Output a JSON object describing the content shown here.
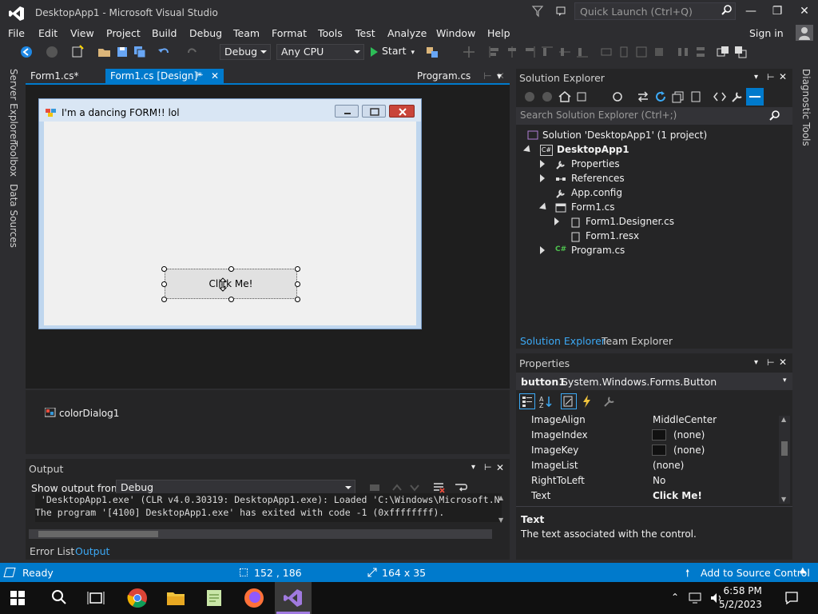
{
  "window": {
    "title": "DesktopApp1 - Microsoft Visual Studio"
  },
  "quick_launch": {
    "placeholder": "Quick Launch (Ctrl+Q)"
  },
  "menu": [
    "File",
    "Edit",
    "View",
    "Project",
    "Build",
    "Debug",
    "Team",
    "Format",
    "Tools",
    "Test",
    "Analyze",
    "Window",
    "Help"
  ],
  "signin": "Sign in",
  "toolbar": {
    "config": "Debug",
    "platform": "Any CPU",
    "start": "Start"
  },
  "left_tabs": [
    "Server Explorer",
    "Toolbox",
    "Data Sources"
  ],
  "right_tabs": [
    "Diagnostic Tools"
  ],
  "doc_tabs": [
    {
      "label": "Form1.cs*"
    },
    {
      "label": "Form1.cs [Design]*"
    },
    {
      "label": "Program.cs"
    }
  ],
  "designer": {
    "form_title": "I'm a dancing FORM!! lol",
    "button_text": "Click Me!",
    "tray_component": "colorDialog1"
  },
  "output": {
    "title": "Output",
    "show_from_label": "Show output from:",
    "source": "Debug",
    "lines": [
      " 'DesktopApp1.exe' (CLR v4.0.30319: DesktopApp1.exe): Loaded 'C:\\Windows\\Microsoft.N",
      "The program '[4100] DesktopApp1.exe' has exited with code -1 (0xffffffff)."
    ]
  },
  "bottom_tabs": [
    "Error List",
    "Output"
  ],
  "solution_explorer": {
    "title": "Solution Explorer",
    "search_placeholder": "Search Solution Explorer (Ctrl+;)",
    "tree": [
      {
        "label": "Solution 'DesktopApp1' (1 project)",
        "level": 0
      },
      {
        "label": "DesktopApp1",
        "level": 1
      },
      {
        "label": "Properties",
        "level": 2
      },
      {
        "label": "References",
        "level": 2
      },
      {
        "label": "App.config",
        "level": 2
      },
      {
        "label": "Form1.cs",
        "level": 2
      },
      {
        "label": "Form1.Designer.cs",
        "level": 3
      },
      {
        "label": "Form1.resx",
        "level": 3
      },
      {
        "label": "Program.cs",
        "level": 2
      }
    ],
    "tabs": [
      "Solution Explorer",
      "Team Explorer"
    ]
  },
  "properties": {
    "title": "Properties",
    "object_name": "button1",
    "object_type": "System.Windows.Forms.Button",
    "rows": [
      {
        "name": "ImageAlign",
        "value": "MiddleCenter"
      },
      {
        "name": "ImageIndex",
        "value": "(none)"
      },
      {
        "name": "ImageKey",
        "value": "(none)"
      },
      {
        "name": "ImageList",
        "value": "(none)"
      },
      {
        "name": "RightToLeft",
        "value": "No"
      },
      {
        "name": "Text",
        "value": "Click Me!"
      }
    ],
    "desc_title": "Text",
    "desc_text": "The text associated with the control."
  },
  "status": {
    "state": "Ready",
    "position": "152 , 186",
    "size": "164 x 35",
    "source_control": "Add to Source Control"
  },
  "clock": {
    "time": "6:58 PM",
    "date": "5/2/2023"
  },
  "colors": {
    "accent": "#007acc",
    "bg": "#2d2d30",
    "panel": "#252526"
  }
}
